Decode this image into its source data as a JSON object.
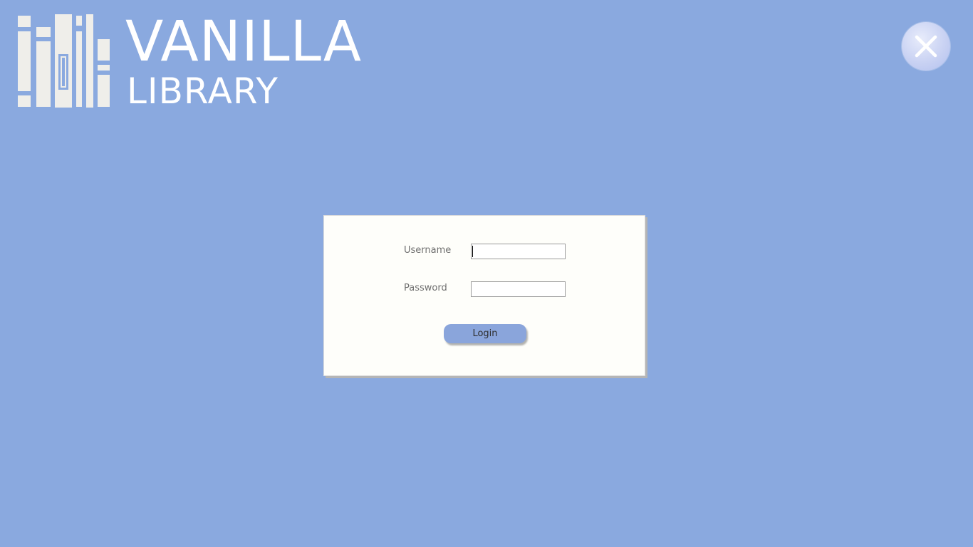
{
  "app": {
    "title_line1": "VANILLA",
    "title_line2": "LIBRARY",
    "logo_icon": "books-logo-icon"
  },
  "window": {
    "close_icon": "close-icon"
  },
  "login": {
    "username_label": "Username",
    "username_value": "",
    "password_label": "Password",
    "password_value": "",
    "submit_label": "Login"
  },
  "colors": {
    "background": "#8aa9df",
    "panel": "#fefefa",
    "button": "#8aa5db",
    "logo": "#eeeeea"
  }
}
